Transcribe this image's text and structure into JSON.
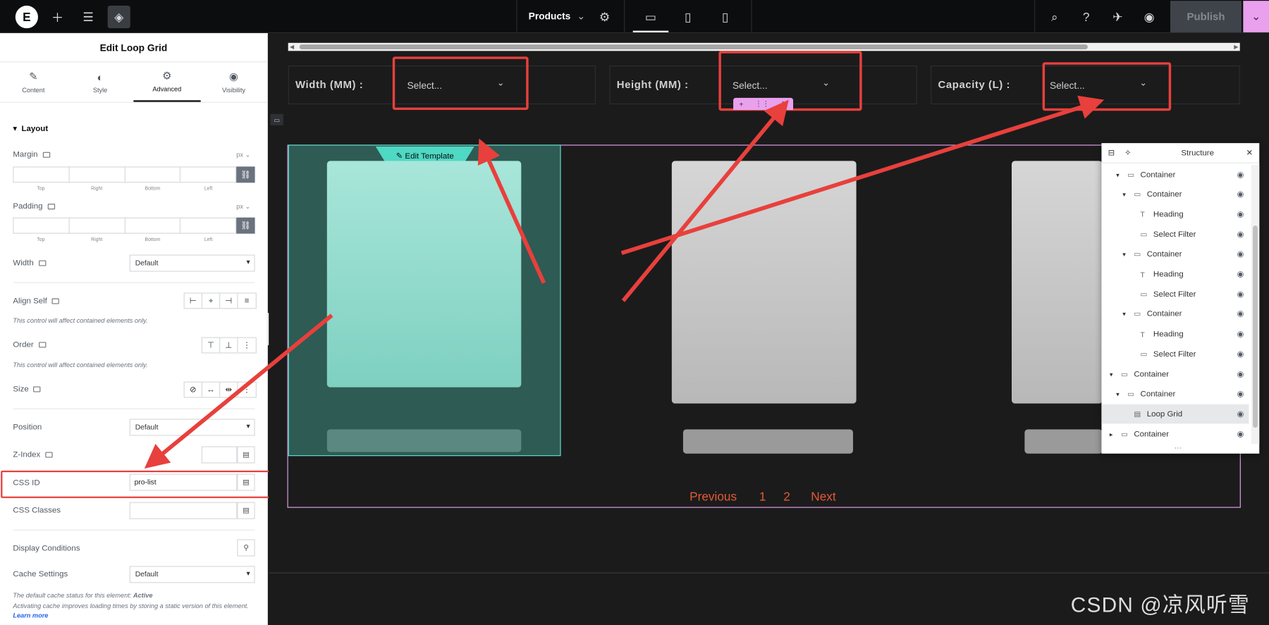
{
  "topbar": {
    "page_name": "Products",
    "publish_label": "Publish"
  },
  "panel": {
    "title": "Edit Loop Grid",
    "tabs": [
      {
        "label": "Content",
        "icon": "pencil-icon"
      },
      {
        "label": "Style",
        "icon": "contrast-icon"
      },
      {
        "label": "Advanced",
        "icon": "gear-icon"
      },
      {
        "label": "Visibility",
        "icon": "eye-icon"
      }
    ],
    "section": "Layout",
    "margin_label": "Margin",
    "padding_label": "Padding",
    "unit": "px",
    "dim_labels": [
      "Top",
      "Right",
      "Bottom",
      "Left"
    ],
    "width_label": "Width",
    "width_value": "Default",
    "align_self_label": "Align Self",
    "align_note": "This control will affect contained elements only.",
    "order_label": "Order",
    "order_note": "This control will affect contained elements only.",
    "size_label": "Size",
    "position_label": "Position",
    "position_value": "Default",
    "zindex_label": "Z-Index",
    "css_id_label": "CSS ID",
    "css_id_value": "pro-list",
    "css_classes_label": "CSS Classes",
    "display_conditions_label": "Display Conditions",
    "cache_label": "Cache Settings",
    "cache_value": "Default",
    "cache_note_prefix": "The default cache status for this element:",
    "cache_note_status": "Active",
    "cache_note_body": "Activating cache improves loading times by storing a static version of this element.",
    "cache_note_link": "Learn more"
  },
  "canvas": {
    "filters": [
      {
        "label": "Width (MM) :",
        "placeholder": "Select..."
      },
      {
        "label": "Height (MM) :",
        "placeholder": "Select..."
      },
      {
        "label": "Capacity (L) :",
        "placeholder": "Select..."
      }
    ],
    "edit_template_label": "Edit Template",
    "pager": {
      "previous": "Previous",
      "pages": [
        "1",
        "2"
      ],
      "next": "Next"
    }
  },
  "structure": {
    "title": "Structure",
    "items": [
      {
        "label": "Container",
        "type": "container",
        "depth": 1,
        "expanded": true
      },
      {
        "label": "Container",
        "type": "container",
        "depth": 2,
        "expanded": true
      },
      {
        "label": "Heading",
        "type": "heading",
        "depth": 3
      },
      {
        "label": "Select Filter",
        "type": "filter",
        "depth": 3
      },
      {
        "label": "Container",
        "type": "container",
        "depth": 2,
        "expanded": true
      },
      {
        "label": "Heading",
        "type": "heading",
        "depth": 3
      },
      {
        "label": "Select Filter",
        "type": "filter",
        "depth": 3
      },
      {
        "label": "Container",
        "type": "container",
        "depth": 2,
        "expanded": true
      },
      {
        "label": "Heading",
        "type": "heading",
        "depth": 3
      },
      {
        "label": "Select Filter",
        "type": "filter",
        "depth": 3
      },
      {
        "label": "Container",
        "type": "container",
        "depth": 0,
        "expanded": true
      },
      {
        "label": "Container",
        "type": "container",
        "depth": 1,
        "expanded": true
      },
      {
        "label": "Loop Grid",
        "type": "loop",
        "depth": 2,
        "selected": true
      },
      {
        "label": "Container",
        "type": "container",
        "depth": 0,
        "expanded": false
      }
    ]
  },
  "watermark": "CSDN @凉风听雪",
  "colors": {
    "accent_red": "#e8403c",
    "pink": "#e9a1ed",
    "teal": "#4fd8c3",
    "pager": "#e35a35"
  }
}
